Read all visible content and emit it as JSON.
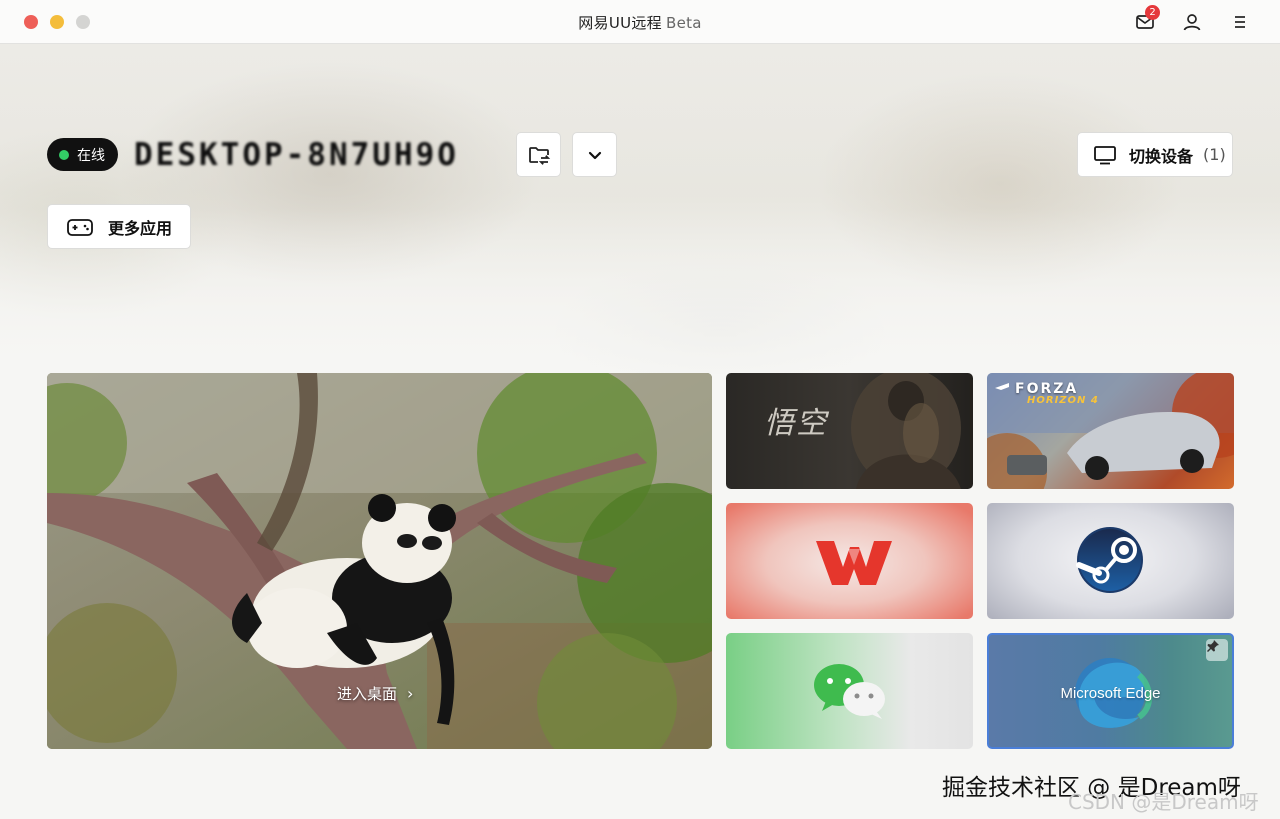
{
  "window": {
    "title": "网易UU远程",
    "title_suffix": "Beta",
    "mail_badge_count": "2"
  },
  "device": {
    "status_label": "在线",
    "name": "DESKTOP-8N7UH9O",
    "switch_button_label": "切换设备",
    "switch_button_count": "(1)"
  },
  "more_apps": {
    "label": "更多应用"
  },
  "desktop_card": {
    "enter_label": "进入桌面"
  },
  "apps": {
    "wukong": {
      "title": "悟空"
    },
    "forza": {
      "title": "FORZA",
      "subtitle": "HORIZON 4"
    },
    "edge": {
      "label": "Microsoft Edge"
    }
  },
  "watermark": {
    "main": "掘金技术社区 @ 是Dream呀",
    "csdn": "CSDN @是Dream呀"
  },
  "colors": {
    "online_dot": "#33cc66",
    "badge": "#e5383b",
    "edge_selected_border": "#4a7ed8"
  }
}
